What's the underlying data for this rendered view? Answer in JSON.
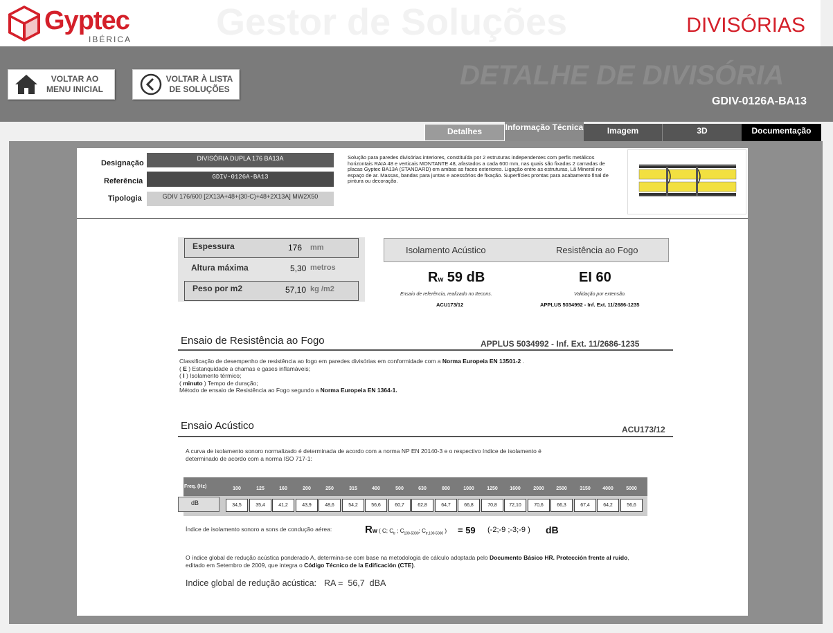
{
  "header": {
    "brand": "Gyptec",
    "brand_sub": "IBÉRICA",
    "ghost_title": "Gestor de Soluções",
    "section": "DIVISÓRIAS"
  },
  "band": {
    "btn_home": "VOLTAR AO MENU INICIAL",
    "btn_list": "VOLTAR À LISTA DE SOLUÇÕES",
    "ghost_title": "DETALHE DE DIVISÓRIA",
    "code": "GDIV-0126A-BA13"
  },
  "tabs": [
    "Detalhes",
    "Informação Técnica",
    "Imagem",
    "3D",
    "Documentação"
  ],
  "info": {
    "designacao_label": "Designação",
    "designacao": "DIVISÓRIA DUPLA 176 BA13A",
    "referencia_label": "Referência",
    "referencia": "GDIV-0126A-BA13",
    "tipologia_label": "Tipologia",
    "tipologia": "GDIV 176/600 [2X13A+48+(30-C)+48+2X13A] MW2X50",
    "description": "Solução para paredes divisórias interiores, constituída por 2 estruturas independentes com perfis metálicos horizontais RAIA 48 e verticais MONTANTE 48, afastados a cada 600 mm, nas quais são fixadas 2 camadas de placas Gyptec BA13A (STANDARD) em ambas as faces exteriores. Ligação entre as estruturas, Lã Mineral no espaço de ar.  Massas, bandas para juntas e acessórios de fixação. Superfícies prontas para acabamento final de pintura ou decoração."
  },
  "props": [
    {
      "label": "Espessura",
      "value": "176",
      "unit": "mm"
    },
    {
      "label": "Altura máxima",
      "value": "5,30",
      "unit": "metros"
    },
    {
      "label": "Peso por m2",
      "value": "57,10",
      "unit": "kg /m2"
    }
  ],
  "performance": {
    "acoustic_title": "Isolamento Acústico",
    "fire_title": "Resistência ao Fogo",
    "rw_symbol": "R",
    "rw_sub": "w",
    "rw_value": "59 dB",
    "fire_value": "EI 60",
    "acoustic_note": "Ensaio de referência, realizado no Itecons.",
    "acoustic_ref": "ACU173/12",
    "fire_note": "Validação por extensão.",
    "fire_ref": "APPLUS 5034992 - Inf. Ext. 11/2686-1235"
  },
  "fire_section": {
    "title": "Ensaio de Resistência ao Fogo",
    "ref": "APPLUS 5034992 - Inf. Ext. 11/2686-1235",
    "l1": "Classificação de desempenho de resistência ao fogo em paredes divisórias em conformidade com a ",
    "l1b": "Norma Europeia EN 13501-2",
    "l1c": " .",
    "l2a": "( ",
    "l2b": "E",
    "l2c": " ) Estanquidade a chamas e gases inflamáveis;",
    "l3a": "( ",
    "l3b": "I",
    "l3c": " ) Isolamento térmico;",
    "l4a": "( ",
    "l4b": "minuto",
    "l4c": " ) Tempo de duração;",
    "l5": "Método de ensaio de Resistência ao Fogo segundo a ",
    "l5b": "Norma Europeia EN 1364-1."
  },
  "acoustic_section": {
    "title": "Ensaio Acústico",
    "ref": "ACU173/12",
    "intro": "A curva de isolamento sonoro normalizado é determinada de acordo com a norma NP EN 20140-3 e o respectivo índice de isolamento é determinado de acordo com a norma ISO 717-1:",
    "freq_label": "Freq. (Hz)",
    "db_label": "dB",
    "frequencies": [
      "100",
      "125",
      "160",
      "200",
      "250",
      "315",
      "400",
      "500",
      "630",
      "800",
      "1000",
      "1250",
      "1600",
      "2000",
      "2500",
      "3150",
      "4000",
      "5000"
    ],
    "values": [
      "34,5",
      "35,4",
      "41,2",
      "43,9",
      "48,6",
      "54,2",
      "56,6",
      "60,7",
      "62,8",
      "64,7",
      "66,8",
      "70,8",
      "72,10",
      "70,6",
      "66,3",
      "67,4",
      "64,2",
      "56,6"
    ],
    "index_label": "Índice de isolamento sonoro a sons de condução aérea:",
    "index_formula": "R",
    "index_sub": "w",
    "index_terms": "( C; C",
    "index_terms2": "tr",
    "index_terms3": " ; C",
    "index_terms4": "100-5000",
    "index_terms5": "; C",
    "index_terms6": "tr,100-5000",
    "index_terms7": " )",
    "index_eq": "=  59",
    "index_corr": "(-2;-9 ;-3;-9   )",
    "index_unit": "dB",
    "ra_note1": "O índice global de redução acústica ponderado A, determina-se com base na metodologia de cálculo adoptada pelo ",
    "ra_note1b": "Documento Básico HR. Protección frente al ruido",
    "ra_note2": ", editado em Setembro de 2009, que integra o ",
    "ra_note2b": "Código Técnico de la Edificación (CTE)",
    "ra_note2c": ".",
    "ra_label": "Indice global de redução acústica:",
    "ra_value": "RA =  56,7  dBA"
  }
}
